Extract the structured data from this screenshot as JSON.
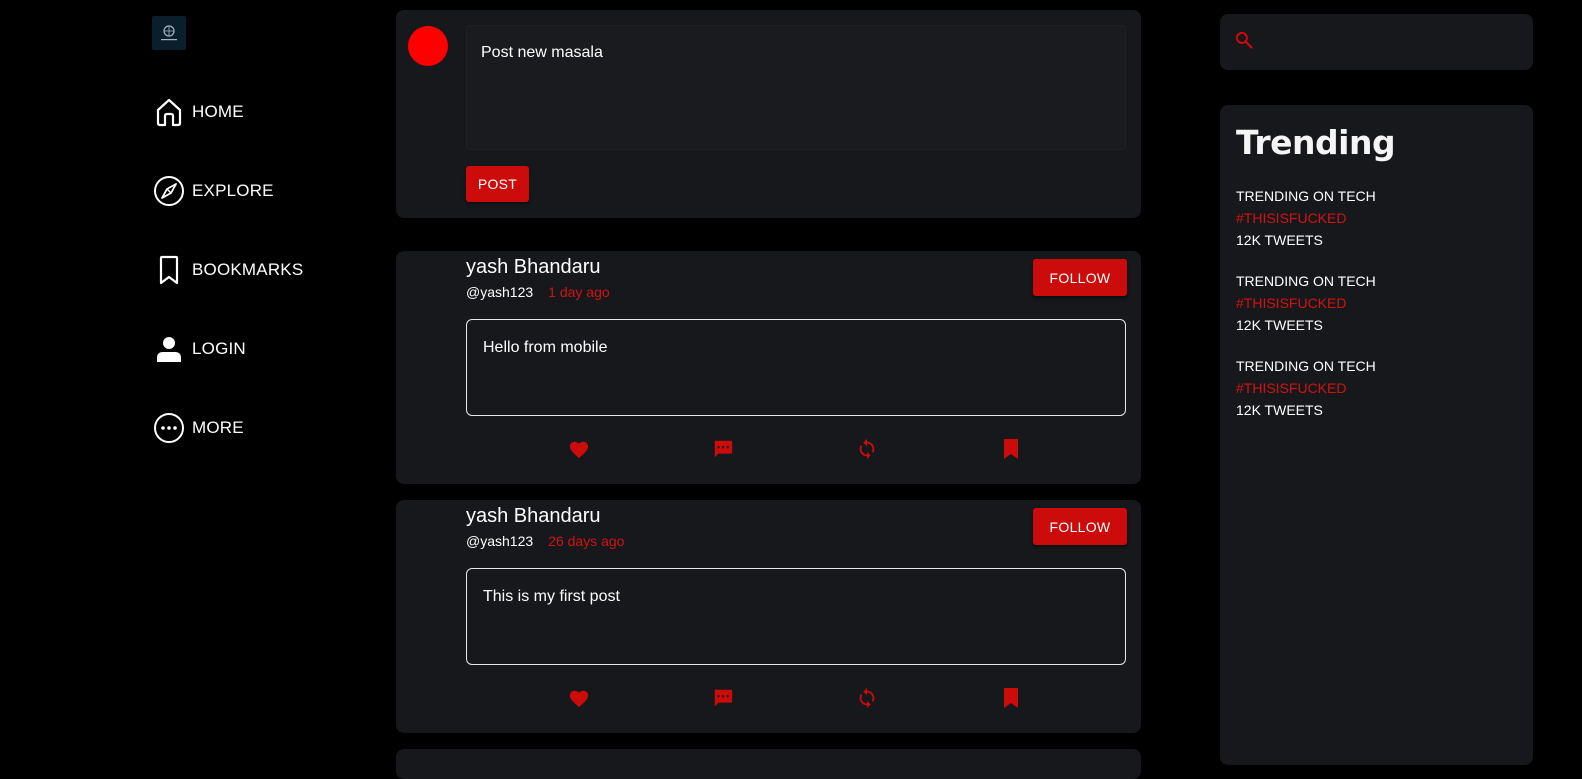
{
  "sidebar": {
    "items": [
      {
        "label": "HOME",
        "icon": "home-icon"
      },
      {
        "label": "EXPLORE",
        "icon": "compass-icon"
      },
      {
        "label": "BOOKMARKS",
        "icon": "bookmark-icon"
      },
      {
        "label": "LOGIN",
        "icon": "user-icon"
      },
      {
        "label": "MORE",
        "icon": "more-icon"
      }
    ]
  },
  "compose": {
    "placeholder": "Post new masala",
    "post_label": "POST"
  },
  "feed": {
    "posts": [
      {
        "author": "yash Bhandaru",
        "handle": "@yash123",
        "time": "1 day ago",
        "follow_label": "FOLLOW",
        "body": "Hello from mobile"
      },
      {
        "author": "yash Bhandaru",
        "handle": "@yash123",
        "time": "26 days ago",
        "follow_label": "FOLLOW",
        "body": "This is my first post"
      }
    ]
  },
  "search": {
    "placeholder": ""
  },
  "trending": {
    "title": "Trending",
    "items": [
      {
        "topic": "TRENDING ON TECH",
        "tag": "#THISISFUCKED",
        "count": "12K TWEETS"
      },
      {
        "topic": "TRENDING ON TECH",
        "tag": "#THISISFUCKED",
        "count": "12K TWEETS"
      },
      {
        "topic": "TRENDING ON TECH",
        "tag": "#THISISFUCKED",
        "count": "12K TWEETS"
      }
    ]
  },
  "colors": {
    "accent": "#cc0b0b",
    "accent_text": "#d11313",
    "background": "#000000",
    "card": "#17181c"
  }
}
